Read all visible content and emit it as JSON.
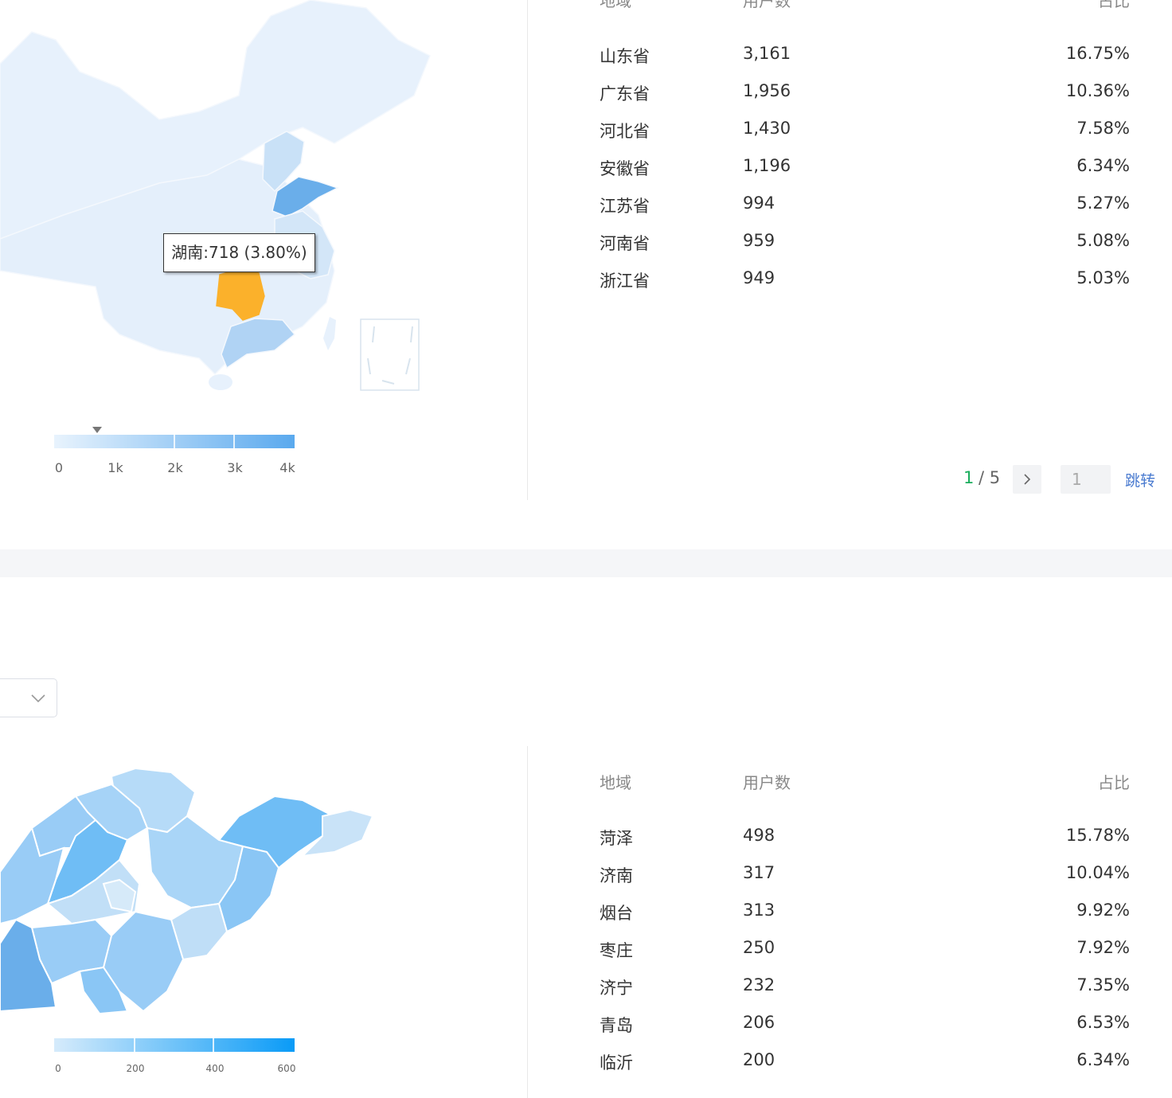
{
  "top_section": {
    "table": {
      "headers": {
        "region": "地域",
        "users": "用户数",
        "share": "占比"
      },
      "rows": [
        {
          "region": "山东省",
          "users": "3,161",
          "share": "16.75%"
        },
        {
          "region": "广东省",
          "users": "1,956",
          "share": "10.36%"
        },
        {
          "region": "河北省",
          "users": "1,430",
          "share": "7.58%"
        },
        {
          "region": "安徽省",
          "users": "1,196",
          "share": "6.34%"
        },
        {
          "region": "江苏省",
          "users": "994",
          "share": "5.27%"
        },
        {
          "region": "河南省",
          "users": "959",
          "share": "5.08%"
        },
        {
          "region": "浙江省",
          "users": "949",
          "share": "5.03%"
        }
      ]
    },
    "map": {
      "tooltip": "湖南:718 (3.80%)",
      "highlight_color": "#fbb12b",
      "legend": {
        "labels": [
          "0",
          "1k",
          "2k",
          "3k",
          "4k"
        ],
        "pointer_value": 718,
        "max": 4000
      }
    },
    "pagination": {
      "current": "1",
      "separator": "/ 5",
      "input_value": "1",
      "go_label": "跳转"
    }
  },
  "bottom_section": {
    "table": {
      "headers": {
        "region": "地域",
        "users": "用户数",
        "share": "占比"
      },
      "rows": [
        {
          "region": "菏泽",
          "users": "498",
          "share": "15.78%"
        },
        {
          "region": "济南",
          "users": "317",
          "share": "10.04%"
        },
        {
          "region": "烟台",
          "users": "313",
          "share": "9.92%"
        },
        {
          "region": "枣庄",
          "users": "250",
          "share": "7.92%"
        },
        {
          "region": "济宁",
          "users": "232",
          "share": "7.35%"
        },
        {
          "region": "青岛",
          "users": "206",
          "share": "6.53%"
        },
        {
          "region": "临沂",
          "users": "200",
          "share": "6.34%"
        }
      ]
    },
    "map": {
      "legend": {
        "labels": [
          "0",
          "200",
          "400",
          "600"
        ]
      }
    },
    "select": {
      "icon": "chevron-down-icon"
    }
  },
  "colors": {
    "accent_green": "#1aad5c",
    "link_blue": "#4a7bd0",
    "legend_top_start": "#e8f3fd",
    "legend_top_end": "#5aa9ee",
    "legend_bottom_start": "#d6ebfb",
    "legend_bottom_end": "#0a9bf7"
  }
}
